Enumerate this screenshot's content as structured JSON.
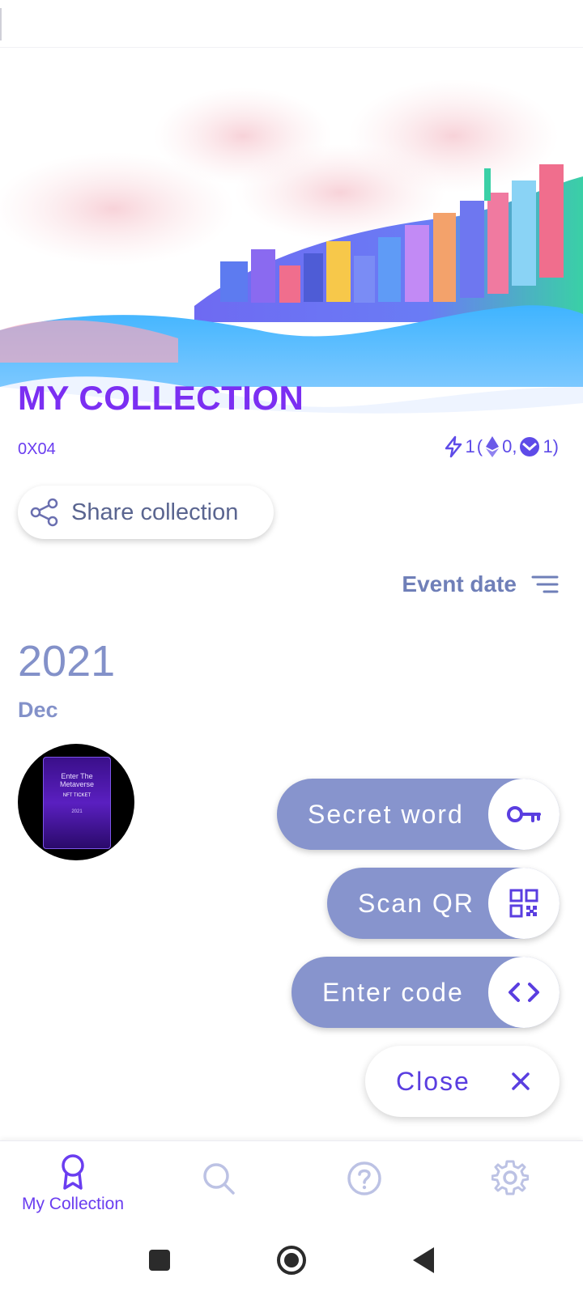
{
  "page": {
    "title": "MY COLLECTION",
    "address_prefix": "0X04"
  },
  "stats": {
    "total": "1",
    "open_paren": "(",
    "eth_count": "0,",
    "gnosis_count": "1)"
  },
  "share": {
    "label": "Share collection"
  },
  "sort": {
    "label": "Event date"
  },
  "groups": [
    {
      "year": "2021",
      "month": "Dec",
      "items": [
        {
          "line1": "Enter The",
          "line2": "Metaverse",
          "badge": "NFT TICKET",
          "year": "2021"
        }
      ]
    }
  ],
  "fab_menu": {
    "secret_word": "Secret word",
    "scan_qr": "Scan QR",
    "enter_code": "Enter code",
    "close": "Close"
  },
  "nav": {
    "my_collection": "My Collection"
  },
  "colors": {
    "accent": "#7b2ff2",
    "fab": "#8794cd",
    "muted": "#8391c9"
  }
}
